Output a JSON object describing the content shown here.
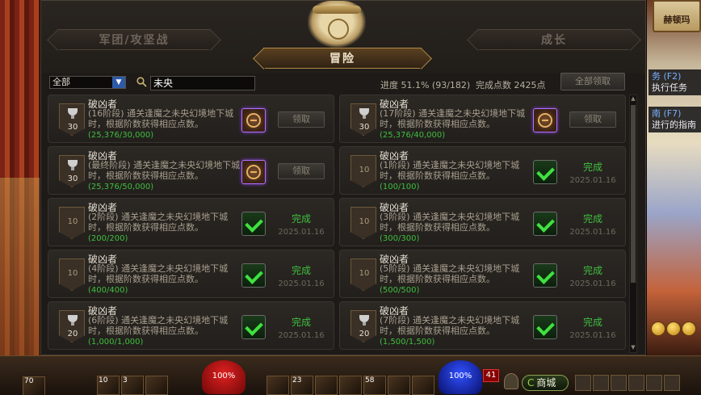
{
  "scene": {
    "sign_text": "赫顿玛",
    "tasks": [
      {
        "key": "务 (F2)",
        "text": "执行任务"
      },
      {
        "key": "南 (F7)",
        "text": "进行的指南"
      }
    ]
  },
  "tabs": {
    "legion": "军团/攻坚战",
    "adventure": "冒险",
    "growth": "成长"
  },
  "filter": {
    "category": "全部",
    "search_value": "未央",
    "progress": "进度 51.1% (93/182)",
    "points": "完成点数 2425点",
    "claim_all": "全部领取"
  },
  "achievements": [
    {
      "title": "破凶者",
      "desc": "(16阶段) 通关逢魔之未央幻境地下城时，根据阶数获得相应点数。",
      "progress": "(25,376/30,000)",
      "points": "30",
      "cup": true,
      "state": "claimable",
      "action": "领取",
      "date": ""
    },
    {
      "title": "破凶者",
      "desc": "(17阶段) 通关逢魔之未央幻境地下城时，根据阶数获得相应点数。",
      "progress": "(25,376/40,000)",
      "points": "30",
      "cup": true,
      "state": "claimable",
      "action": "领取",
      "date": ""
    },
    {
      "title": "破凶者",
      "desc": "(最终阶段) 通关逢魔之未央幻境地下城时，根据阶数获得相应点数。",
      "progress": "(25,376/50,000)",
      "points": "30",
      "cup": true,
      "state": "claimable",
      "action": "领取",
      "date": ""
    },
    {
      "title": "破凶者",
      "desc": "(1阶段) 通关逢魔之未央幻境地下城时，根据阶数获得相应点数。",
      "progress": "(100/100)",
      "points": "10",
      "cup": false,
      "state": "done",
      "action": "完成",
      "date": "2025.01.16"
    },
    {
      "title": "破凶者",
      "desc": "(2阶段) 通关逢魔之未央幻境地下城时，根据阶数获得相应点数。",
      "progress": "(200/200)",
      "points": "10",
      "cup": false,
      "state": "done",
      "action": "完成",
      "date": "2025.01.16"
    },
    {
      "title": "破凶者",
      "desc": "(3阶段) 通关逢魔之未央幻境地下城时，根据阶数获得相应点数。",
      "progress": "(300/300)",
      "points": "10",
      "cup": false,
      "state": "done",
      "action": "完成",
      "date": "2025.01.16"
    },
    {
      "title": "破凶者",
      "desc": "(4阶段) 通关逢魔之未央幻境地下城时，根据阶数获得相应点数。",
      "progress": "(400/400)",
      "points": "10",
      "cup": false,
      "state": "done",
      "action": "完成",
      "date": "2025.01.16"
    },
    {
      "title": "破凶者",
      "desc": "(5阶段) 通关逢魔之未央幻境地下城时，根据阶数获得相应点数。",
      "progress": "(500/500)",
      "points": "10",
      "cup": false,
      "state": "done",
      "action": "完成",
      "date": "2025.01.16"
    },
    {
      "title": "破凶者",
      "desc": "(6阶段) 通关逢魔之未央幻境地下城时，根据阶数获得相应点数。",
      "progress": "(1,000/1,000)",
      "points": "20",
      "cup": true,
      "state": "done",
      "action": "完成",
      "date": "2025.01.16"
    },
    {
      "title": "破凶者",
      "desc": "(7阶段) 通关逢魔之未央幻境地下城时，根据阶数获得相应点数。",
      "progress": "(1,500/1,500)",
      "points": "20",
      "cup": true,
      "state": "done",
      "action": "完成",
      "date": "2025.01.16"
    }
  ],
  "hud": {
    "level": "70",
    "hp": "100%",
    "mp": "100%",
    "fatigue": "41",
    "shop_label": "商城",
    "shop_icon": "C",
    "slots": [
      "10",
      "3",
      "23",
      "58"
    ]
  }
}
